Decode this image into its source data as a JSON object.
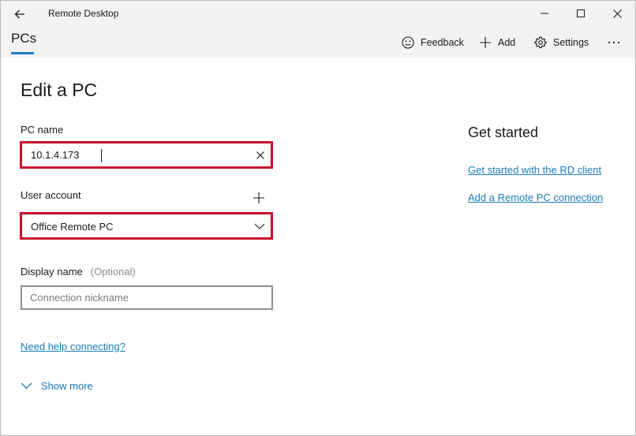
{
  "window": {
    "title": "Remote Desktop"
  },
  "nav": {
    "pcs_tab": "PCs"
  },
  "toolbar": {
    "feedback_label": "Feedback",
    "add_label": "Add",
    "settings_label": "Settings"
  },
  "form": {
    "title": "Edit a PC",
    "pc_name_label": "PC name",
    "pc_name_value": "10.1.4.173",
    "user_account_label": "User account",
    "user_account_value": "Office Remote PC",
    "display_name_label": "Display name",
    "display_name_optional": "(Optional)",
    "display_name_placeholder": "Connection nickname",
    "display_name_value": "",
    "help_link": "Need help connecting?",
    "show_more_label": "Show more"
  },
  "side": {
    "heading": "Get started",
    "links": [
      "Get started with the RD client",
      "Add a Remote PC connection"
    ]
  },
  "colors": {
    "accent": "#1f7ec9",
    "link": "#1a7bb5",
    "highlight": "#c8102e",
    "chrome_bg": "#f2f2f2"
  },
  "icons": {
    "back": "arrow-left-icon",
    "minimize": "minimize-icon",
    "maximize": "maximize-icon",
    "close": "close-icon",
    "feedback": "smiley-icon",
    "add": "plus-icon",
    "settings": "gear-icon",
    "more": "ellipsis-icon",
    "clear": "x-icon",
    "dropdown": "chevron-down-icon"
  }
}
